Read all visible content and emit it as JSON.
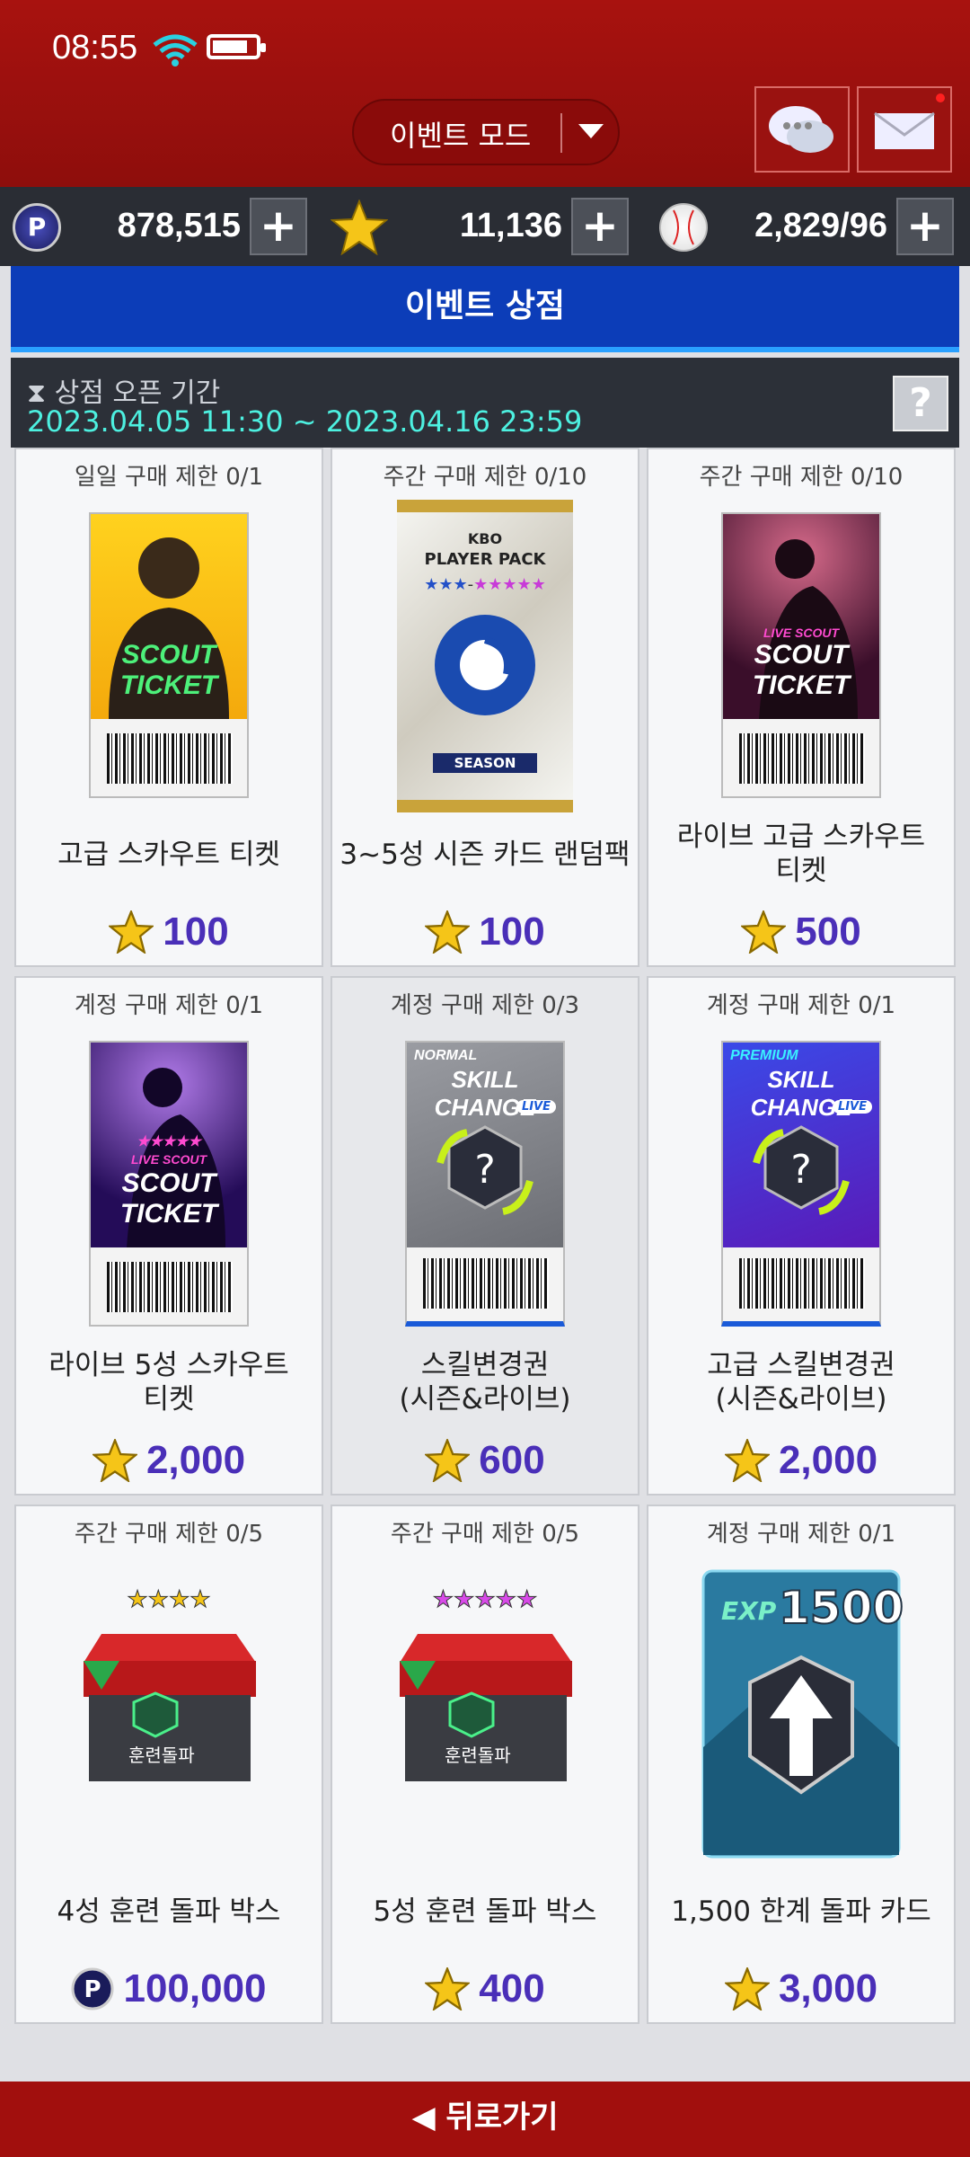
{
  "status": {
    "time": "08:55"
  },
  "header": {
    "mode_label": "이벤트 모드"
  },
  "currency": {
    "points": "878,515",
    "stars": "11,136",
    "balls": "2,829/96"
  },
  "shop": {
    "title": "이벤트 상점",
    "period_label": "상점 오픈 기간",
    "period_value": "2023.04.05 11:30 ~ 2023.04.16 23:59",
    "help": "?"
  },
  "items": [
    {
      "limit": "일일 구매 제한 0/1",
      "name": "고급 스카우트 티켓",
      "price": "100",
      "currency": "star",
      "art": "ticket-yellow"
    },
    {
      "limit": "주간 구매 제한 0/10",
      "name": "3~5성 시즌 카드 랜덤팩",
      "price": "100",
      "currency": "star",
      "art": "pack",
      "pack_line1": "KBO",
      "pack_line2": "PLAYER PACK",
      "pack_tag": "SEASON"
    },
    {
      "limit": "주간 구매 제한 0/10",
      "name": "라이브 고급 스카우트\n티켓",
      "price": "500",
      "currency": "star",
      "art": "ticket-live"
    },
    {
      "limit": "계정 구매 제한 0/1",
      "name": "라이브 5성 스카우트\n티켓",
      "price": "2,000",
      "currency": "star",
      "art": "ticket-live5"
    },
    {
      "limit": "계정 구매 제한 0/3",
      "name": "스킬변경권\n(시즌&라이브)",
      "price": "600",
      "currency": "star",
      "art": "skill-normal"
    },
    {
      "limit": "계정 구매 제한 0/1",
      "name": "고급 스킬변경권\n(시즌&라이브)",
      "price": "2,000",
      "currency": "star",
      "art": "skill-premium"
    },
    {
      "limit": "주간 구매 제한 0/5",
      "name": "4성 훈련 돌파 박스",
      "price": "100,000",
      "currency": "point",
      "art": "box4"
    },
    {
      "limit": "주간 구매 제한 0/5",
      "name": "5성 훈련 돌파 박스",
      "price": "400",
      "currency": "star",
      "art": "box5"
    },
    {
      "limit": "계정 구매 제한 0/1",
      "name": "1,500 한계 돌파 카드",
      "price": "3,000",
      "currency": "star",
      "art": "exp"
    }
  ],
  "art_text": {
    "scout": "SCOUT",
    "ticket": "TICKET",
    "live_scout": "LIVE SCOUT",
    "normal": "NORMAL",
    "premium": "PREMIUM",
    "skill_change": "SKILL CHANGE",
    "live": "LIVE",
    "box_label": "훈련돌파",
    "exp": "EXP",
    "exp_value": "1500"
  },
  "footer": {
    "back": "◀ 뒤로가기"
  }
}
